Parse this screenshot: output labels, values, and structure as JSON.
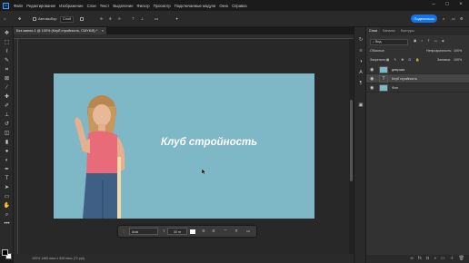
{
  "app": {
    "logo": "Ps"
  },
  "menu": [
    "Файл",
    "Редактирование",
    "Изображение",
    "Слои",
    "Текст",
    "Выделение",
    "Фильтр",
    "Просмотр",
    "Подключаемые модули",
    "Окно",
    "Справка"
  ],
  "options": {
    "auto_select_label": "Автовыбор",
    "auto_select_value": "Слой",
    "share_label": "Поделиться"
  },
  "document": {
    "tab_title": "Без имени-1 @ 100% (Клуб стройность, CMYK/8) *",
    "canvas_text": "Клуб стройность",
    "canvas_bg": "#7eb7c5"
  },
  "status": {
    "text": "100%   1469 пикс x 826 пикс (72 ppi)"
  },
  "context_bar": {
    "font": "Arial",
    "size": "30 пт",
    "more": "•••"
  },
  "layers_panel": {
    "tabs": [
      "Слои",
      "Каналы",
      "Контуры"
    ],
    "search_value": "Вид",
    "blend_mode": "Обычные",
    "opacity_label": "Непрозрачность:",
    "opacity_value": "100%",
    "lock_label": "Закрепить:",
    "fill_label": "Заливка:",
    "fill_value": "100%",
    "layers": [
      {
        "name": "девушка",
        "type": "image",
        "selected": false
      },
      {
        "name": "Клуб стройность",
        "type": "text",
        "selected": true
      },
      {
        "name": "Фон",
        "type": "fill",
        "selected": false
      }
    ]
  },
  "colors": {
    "accent": "#1473e6",
    "foreground": "#000000",
    "background": "#ffffff"
  }
}
